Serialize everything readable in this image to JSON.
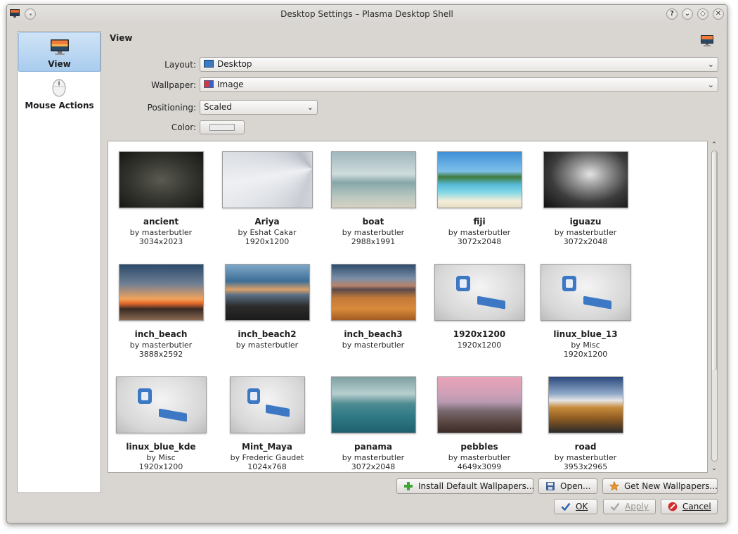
{
  "window": {
    "title": "Desktop Settings – Plasma Desktop Shell"
  },
  "titlebar_buttons": [
    {
      "name": "help",
      "glyph": "?"
    },
    {
      "name": "minimize",
      "glyph": "⌄"
    },
    {
      "name": "maximize",
      "glyph": "◇"
    },
    {
      "name": "close",
      "glyph": "✕"
    }
  ],
  "sidebar": {
    "items": [
      {
        "label": "View",
        "selected": true,
        "icon": "monitor-icon"
      },
      {
        "label": "Mouse Actions",
        "selected": false,
        "icon": "mouse-icon"
      }
    ]
  },
  "main": {
    "heading": "View",
    "layout": {
      "label": "Layout:",
      "value": "Desktop"
    },
    "wallpaper": {
      "label": "Wallpaper:",
      "value": "Image"
    },
    "positioning": {
      "label": "Positioning:",
      "value": "Scaled"
    },
    "color": {
      "label": "Color:",
      "value": "#ebebeb"
    }
  },
  "wallpapers": [
    {
      "name": "ancient",
      "author": "by masterbutler",
      "res": "3034x2023"
    },
    {
      "name": "Ariya",
      "author": "by Eshat Cakar",
      "res": "1920x1200"
    },
    {
      "name": "boat",
      "author": "by masterbutler",
      "res": "2988x1991"
    },
    {
      "name": "fiji",
      "author": "by masterbutler",
      "res": "3072x2048"
    },
    {
      "name": "iguazu",
      "author": "by masterbutler",
      "res": "3072x2048"
    },
    {
      "name": "inch_beach",
      "author": "by masterbutler",
      "res": "3888x2592"
    },
    {
      "name": "inch_beach2",
      "author": "by masterbutler",
      "res": ""
    },
    {
      "name": "inch_beach3",
      "author": "by masterbutler",
      "res": ""
    },
    {
      "name": "1920x1200",
      "author": "1920x1200",
      "res": ""
    },
    {
      "name": "linux_blue_13",
      "author": "by Misc",
      "res": "1920x1200"
    },
    {
      "name": "linux_blue_kde",
      "author": "by Misc",
      "res": "1920x1200"
    },
    {
      "name": "Mint_Maya",
      "author": "by Frederic Gaudet",
      "res": "1024x768"
    },
    {
      "name": "panama",
      "author": "by masterbutler",
      "res": "3072x2048"
    },
    {
      "name": "pebbles",
      "author": "by masterbutler",
      "res": "4649x3099"
    },
    {
      "name": "road",
      "author": "by masterbutler",
      "res": "3953x2965"
    }
  ],
  "buttons": {
    "install": "Install Default Wallpapers...",
    "open": "Open...",
    "get_new": "Get New Wallpapers...",
    "ok": "OK",
    "apply": "Apply",
    "cancel": "Cancel"
  }
}
